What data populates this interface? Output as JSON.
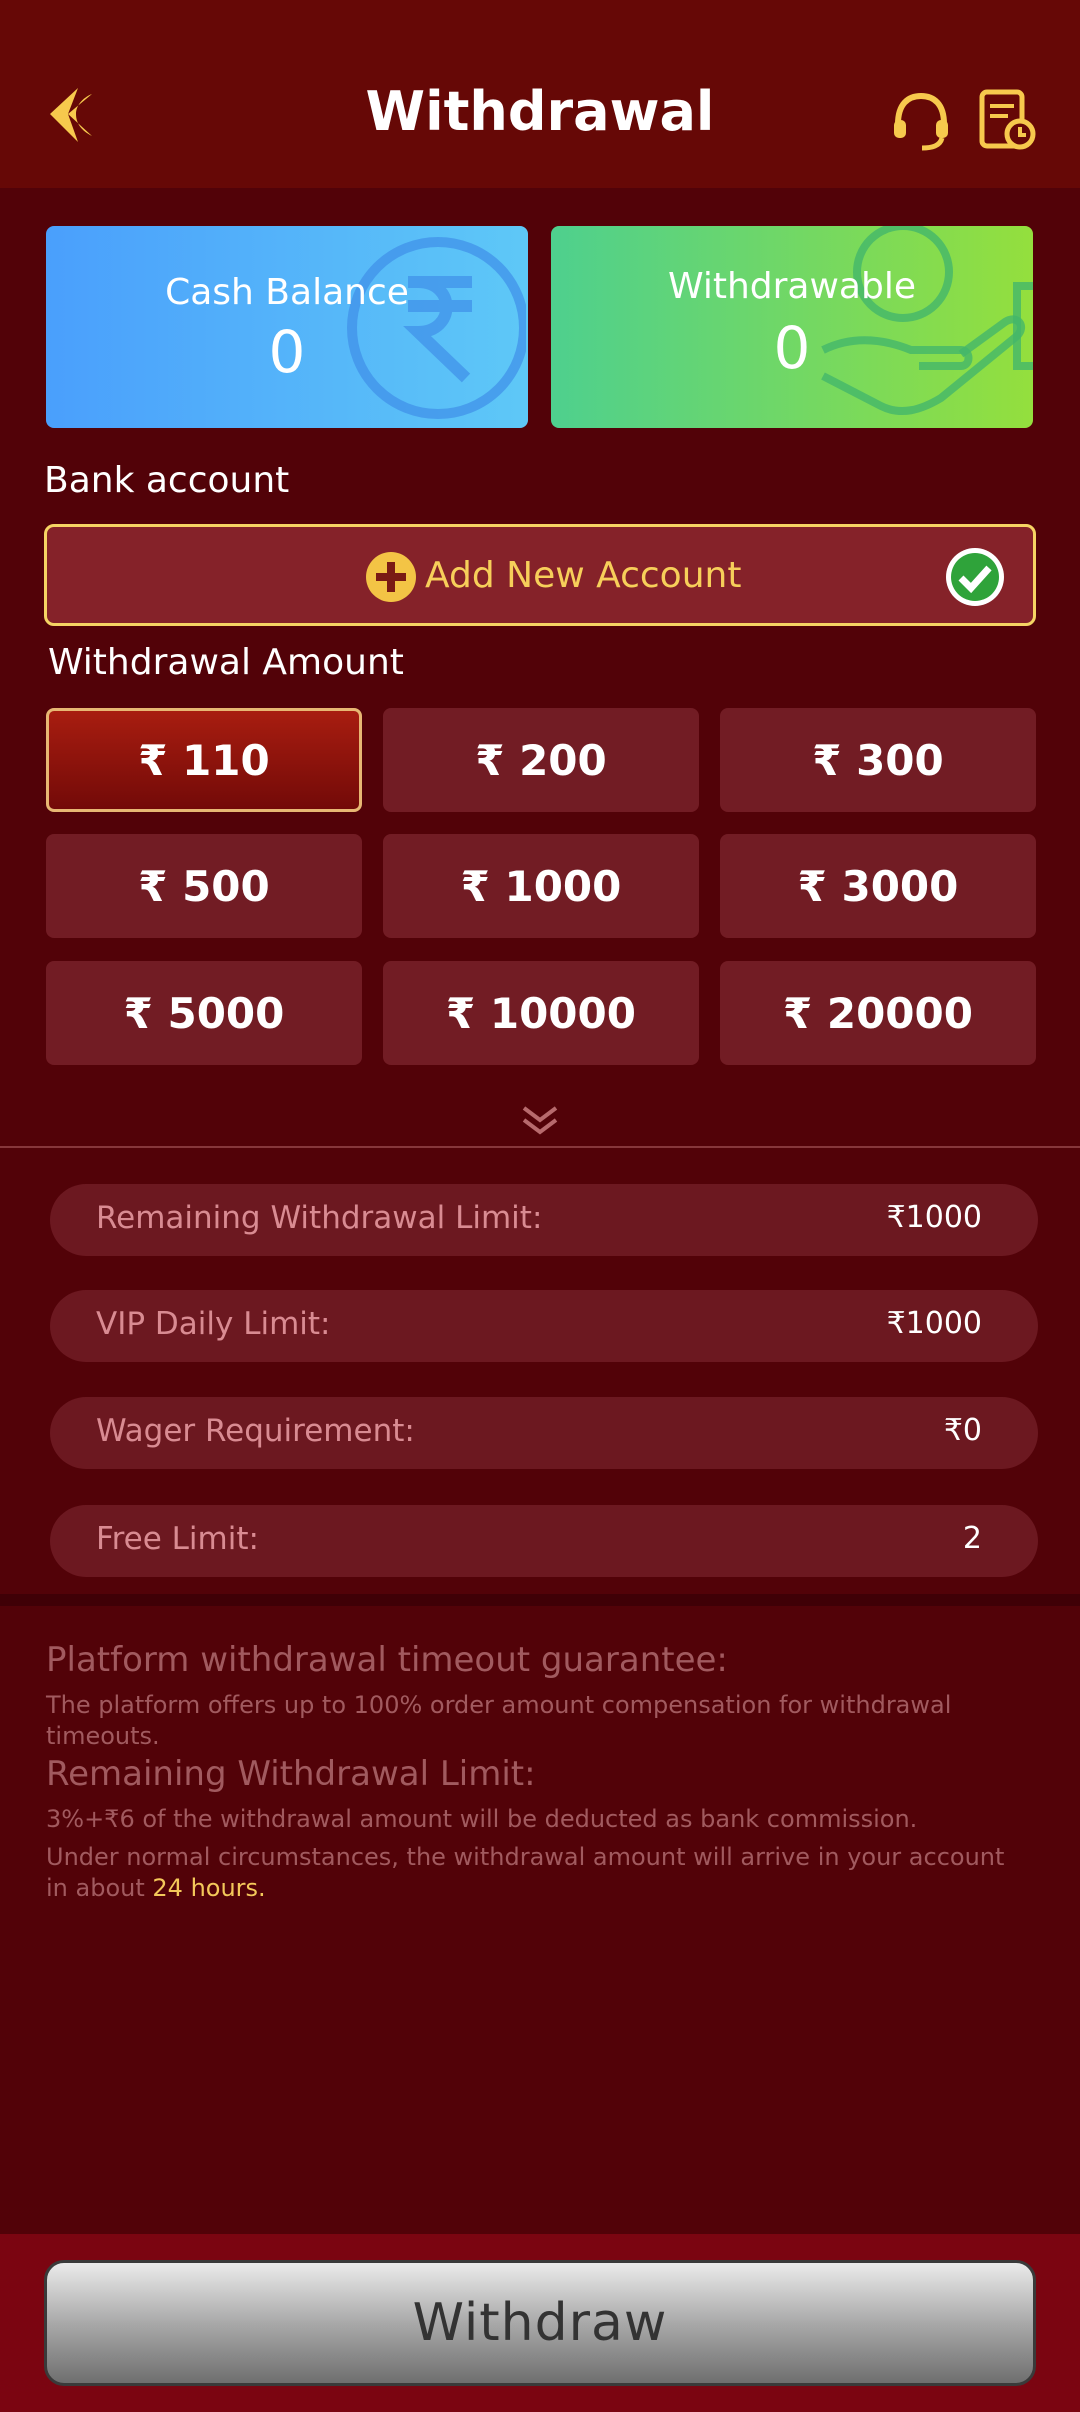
{
  "header": {
    "title": "Withdrawal"
  },
  "balance": {
    "cash_label": "Cash Balance",
    "cash_value": "0",
    "withdrawable_label": "Withdrawable",
    "withdrawable_value": "0"
  },
  "bank": {
    "section_label": "Bank account",
    "add_label": "Add New Account"
  },
  "amount": {
    "section_label": "Withdrawal Amount",
    "options": [
      "₹ 110",
      "₹ 200",
      "₹ 300",
      "₹ 500",
      "₹ 1000",
      "₹ 3000",
      "₹ 5000",
      "₹ 10000",
      "₹ 20000"
    ],
    "selected_index": 0
  },
  "limits": [
    {
      "label": "Remaining Withdrawal Limit:",
      "value": "₹1000"
    },
    {
      "label": "VIP Daily Limit:",
      "value": "₹1000"
    },
    {
      "label": "Wager Requirement:",
      "value": "₹0"
    },
    {
      "label": "Free Limit:",
      "value": "2"
    }
  ],
  "info": {
    "guarantee_title": "Platform withdrawal timeout guarantee:",
    "guarantee_text": "The platform offers up to 100% order amount compensation for withdrawal timeouts.",
    "limit_title": "Remaining Withdrawal Limit:",
    "commission_text": "3%+₹6 of the withdrawal amount will be deducted as bank commission.",
    "arrival_text": "Under normal circumstances, the withdrawal amount will arrive in your account in about",
    "arrival_highlight": "24 hours."
  },
  "footer": {
    "withdraw_label": "Withdraw"
  },
  "colors": {
    "background": "#520208",
    "header": "#660806",
    "gold": "#f7cf5a",
    "cash_card": "#4a9ffc",
    "withdraw_card": "#7ad85a"
  },
  "icons": [
    "back-icon",
    "headset-icon",
    "history-icon",
    "rupee-icon",
    "hand-icon",
    "plus-icon",
    "check-icon",
    "chevron-down-icon"
  ]
}
